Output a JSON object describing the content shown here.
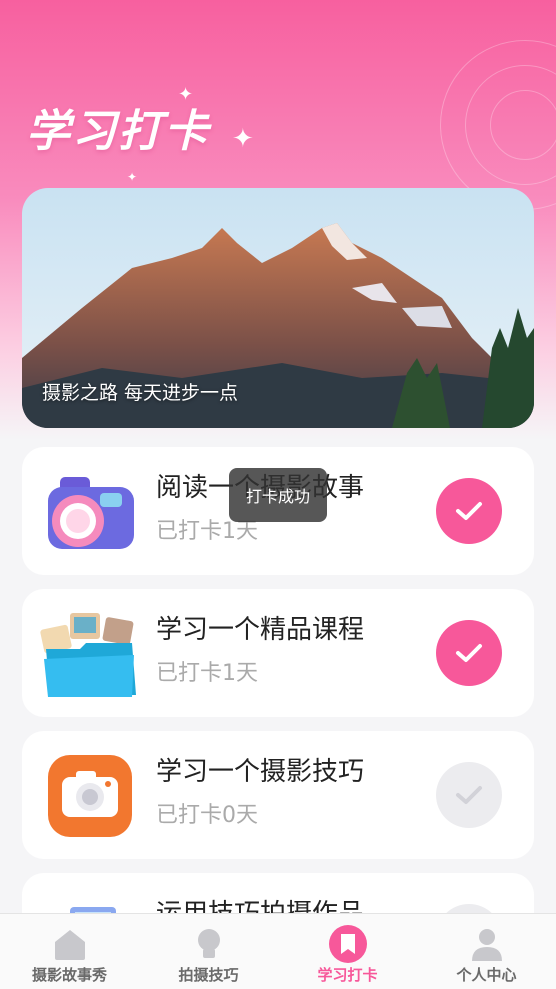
{
  "header": {
    "title": "学习打卡",
    "banner_caption": "摄影之路 每天进步一点"
  },
  "toast": "打卡成功",
  "tasks": [
    {
      "title": "阅读一个摄影故事",
      "status": "已打卡1天",
      "checked": true,
      "icon": "camera-3d-icon"
    },
    {
      "title": "学习一个精品课程",
      "status": "已打卡1天",
      "checked": true,
      "icon": "photo-folder-icon"
    },
    {
      "title": "学习一个摄影技巧",
      "status": "已打卡0天",
      "checked": false,
      "icon": "orange-camera-icon"
    },
    {
      "title": "运用技巧拍摄作品",
      "status": "",
      "checked": false,
      "icon": "picture-frame-icon"
    }
  ],
  "tabbar": {
    "items": [
      {
        "label": "摄影故事秀",
        "icon": "home-icon",
        "active": false
      },
      {
        "label": "拍摄技巧",
        "icon": "lightbulb-icon",
        "active": false
      },
      {
        "label": "学习打卡",
        "icon": "bookmark-icon",
        "active": true
      },
      {
        "label": "个人中心",
        "icon": "person-icon",
        "active": false
      }
    ]
  },
  "colors": {
    "accent": "#f7589a",
    "header_top": "#f7609f",
    "inactive_check": "#ececef"
  }
}
